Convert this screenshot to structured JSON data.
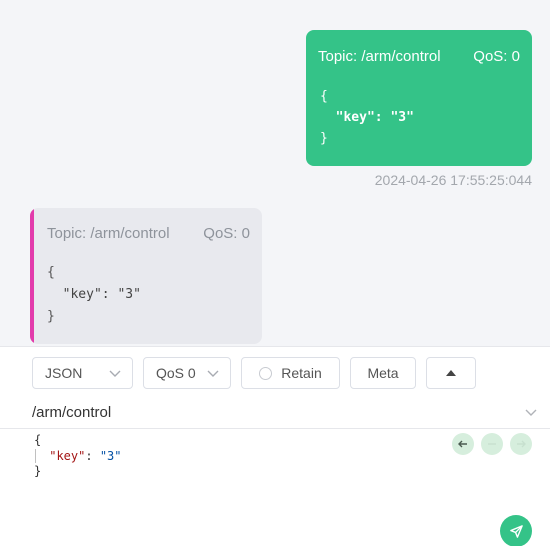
{
  "messages": [
    {
      "direction": "outgoing",
      "topic_label": "Topic: /arm/control",
      "qos_label": "QoS: 0",
      "payload": {
        "open": "{",
        "key": "\"key\"",
        "sep": ": ",
        "value": "\"3\"",
        "close": "}"
      },
      "timestamp": "2024-04-26 17:55:25:044"
    },
    {
      "direction": "incoming",
      "topic_label": "Topic: /arm/control",
      "qos_label": "QoS: 0",
      "payload": {
        "open": "{",
        "key": "\"key\"",
        "sep": ": ",
        "value": "\"3\"",
        "close": "}"
      }
    }
  ],
  "composer": {
    "format_select": "JSON",
    "qos_select": "QoS 0",
    "retain_label": "Retain",
    "meta_label": "Meta",
    "topic_value": "/arm/control",
    "payload": {
      "open": "{",
      "key": "\"key\"",
      "sep": ": ",
      "value": "\"3\"",
      "close": "}"
    },
    "icons": {
      "toggle": "triangle-up-icon",
      "topic_dropdown": "chevron-down-icon",
      "history_prev": "arrow-left-icon",
      "history_clear": "minus-icon",
      "history_next": "arrow-right-icon",
      "send": "send-icon"
    }
  },
  "colors": {
    "outgoing_bubble": "#34c388",
    "incoming_bubble": "#e8e9ee",
    "incoming_accent": "#e23bab",
    "message_area_bg": "#f4f5f8",
    "send_button": "#34c388"
  }
}
